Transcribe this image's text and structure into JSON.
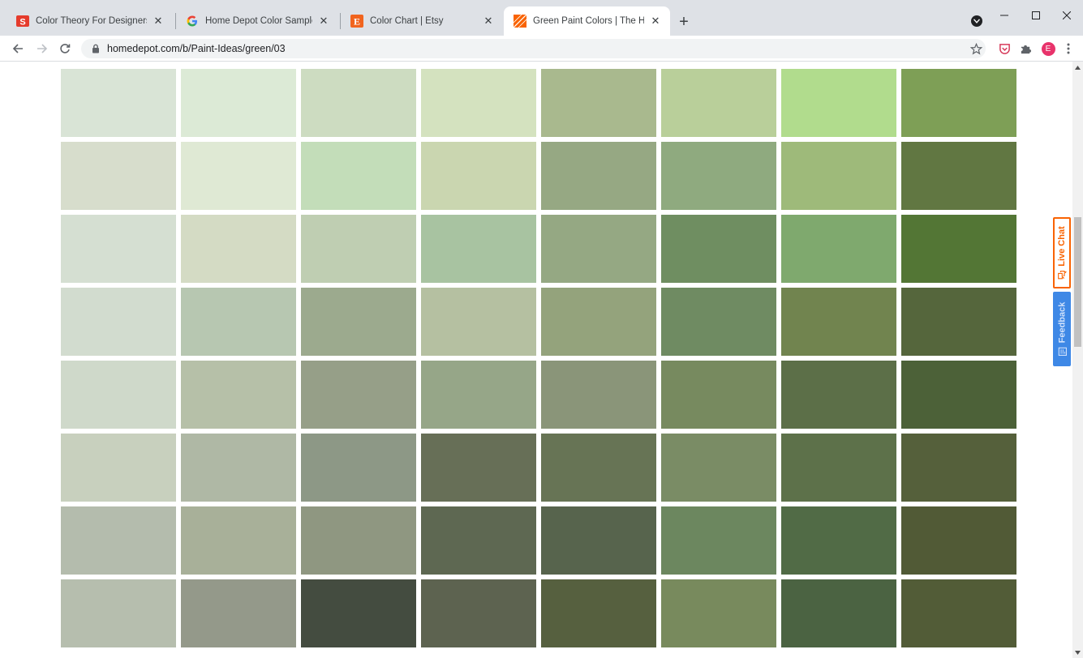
{
  "browser": {
    "tabs": [
      {
        "title": "Color Theory For Designers, Part",
        "favicon": "smashing-icon",
        "active": false
      },
      {
        "title": "Home Depot Color Samples - Go",
        "favicon": "google-icon",
        "active": false
      },
      {
        "title": "Color Chart | Etsy",
        "favicon": "etsy-icon",
        "favicon_letter": "E",
        "active": false
      },
      {
        "title": "Green Paint Colors | The Home D",
        "favicon": "home-depot-icon",
        "active": true
      }
    ],
    "url": "homedepot.com/b/Paint-Ideas/green/03",
    "profile_initial": "E",
    "close_glyph": "✕",
    "new_tab_glyph": "+"
  },
  "page": {
    "live_chat_label": "Live Chat",
    "feedback_label": "Feedback",
    "swatches": [
      [
        "#d9e4d6",
        "#dcead6",
        "#cddcc1",
        "#d4e2bf",
        "#a9b98e",
        "#b9cf9a",
        "#b1dc8d",
        "#7e9f56"
      ],
      [
        "#d7ddcc",
        "#dfe9d4",
        "#c3ddb9",
        "#cad6b0",
        "#96a883",
        "#8faa7f",
        "#9eba7a",
        "#617742"
      ],
      [
        "#d5dfd2",
        "#d4dbc4",
        "#bfceb2",
        "#a8c3a1",
        "#95a883",
        "#6f8e61",
        "#7fa96e",
        "#537635"
      ],
      [
        "#d2dccf",
        "#b7c7b1",
        "#9caa8e",
        "#b5c0a1",
        "#94a37c",
        "#6f8b62",
        "#71844f",
        "#55663c"
      ],
      [
        "#cfd9ca",
        "#b6c0a8",
        "#969f88",
        "#96a688",
        "#8a9579",
        "#778a5f",
        "#5c6f48",
        "#4c6138"
      ],
      [
        "#c8d0be",
        "#afb8a5",
        "#8d9886",
        "#676f57",
        "#677455",
        "#7a8c65",
        "#5d714a",
        "#55603b"
      ],
      [
        "#b4bcad",
        "#a8b099",
        "#8f9781",
        "#5e6852",
        "#57644d",
        "#6c875f",
        "#516b46",
        "#515a36"
      ],
      [
        "#b6beae",
        "#94998a",
        "#444c40",
        "#5d6350",
        "#56603f",
        "#788a5d",
        "#4b6342",
        "#525c37"
      ]
    ]
  }
}
